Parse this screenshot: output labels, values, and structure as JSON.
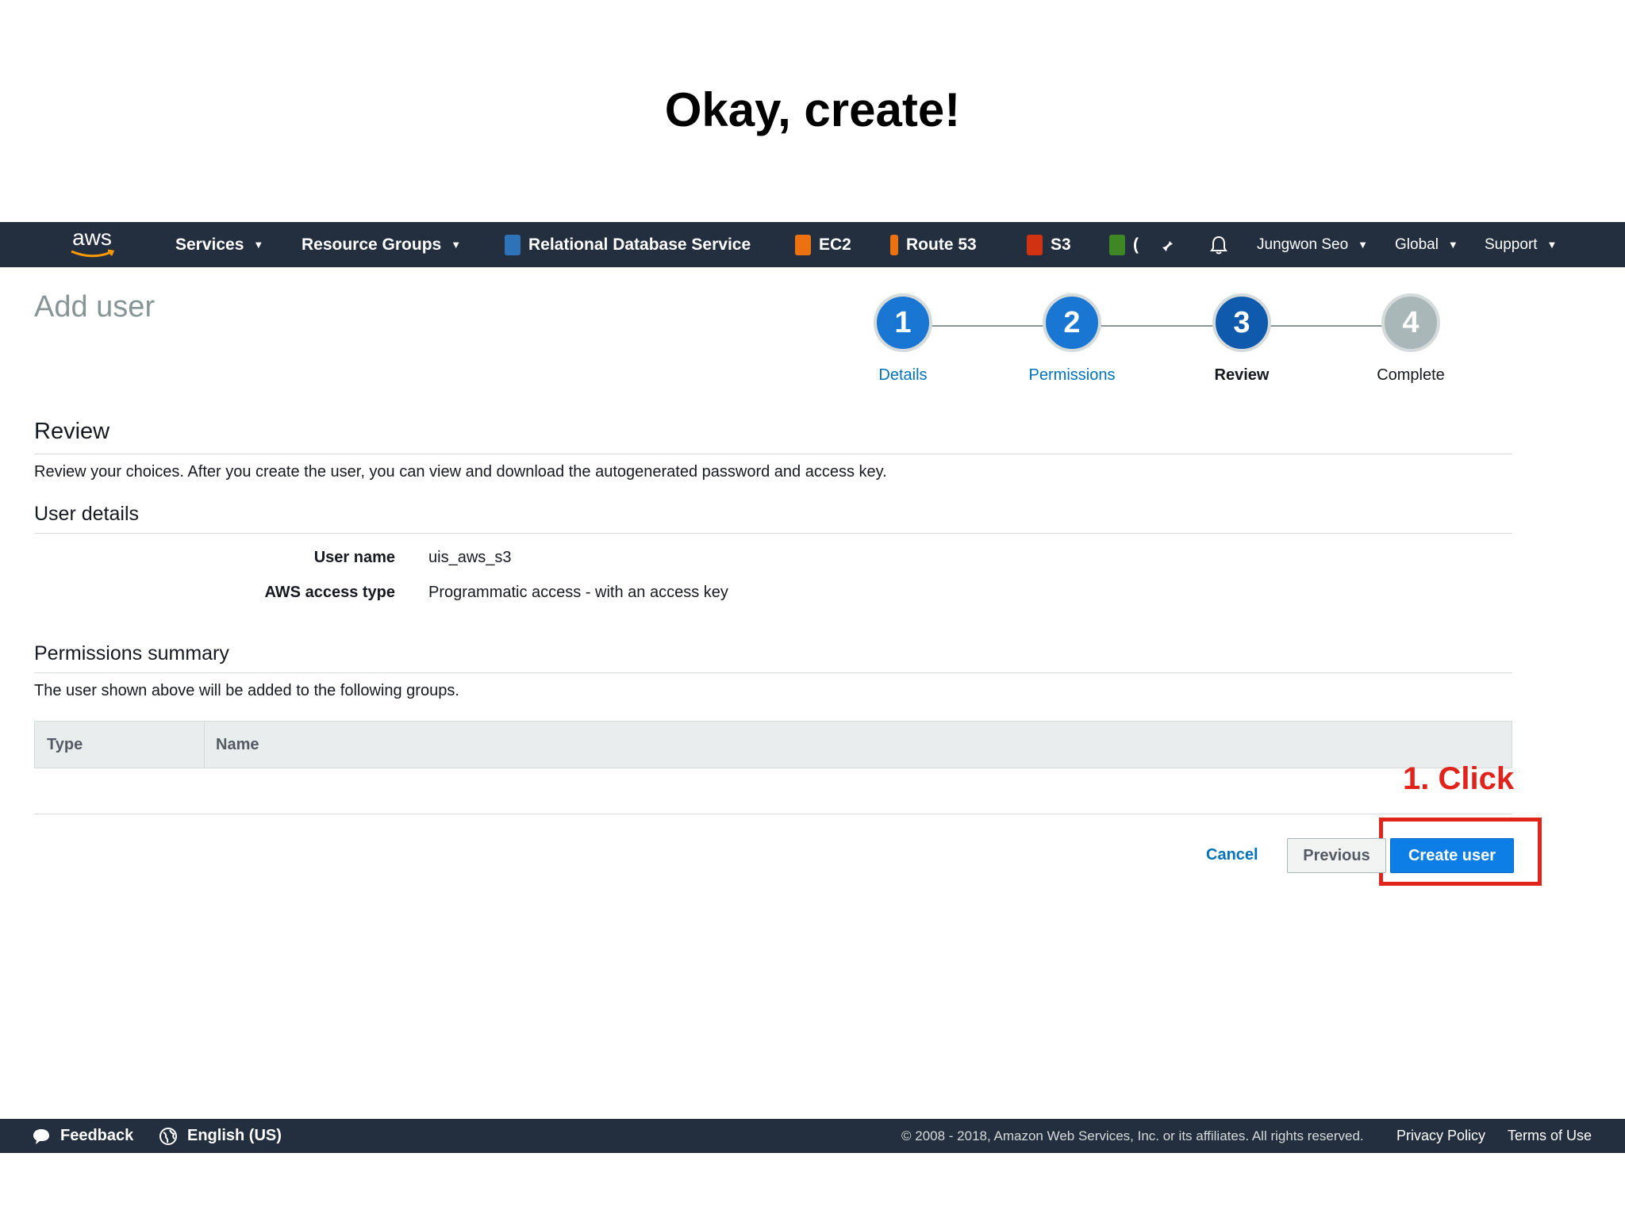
{
  "slide": {
    "title": "Okay, create!"
  },
  "nav": {
    "logo": "aws",
    "services": "Services",
    "resource_groups": "Resource Groups",
    "shortcuts": [
      "Relational Database Service",
      "EC2",
      "Route 53",
      "S3"
    ],
    "truncated": "(",
    "user": "Jungwon Seo",
    "region": "Global",
    "support": "Support"
  },
  "page": {
    "title": "Add user",
    "steps": [
      {
        "number": "1",
        "label": "Details"
      },
      {
        "number": "2",
        "label": "Permissions"
      },
      {
        "number": "3",
        "label": "Review"
      },
      {
        "number": "4",
        "label": "Complete"
      }
    ],
    "review_heading": "Review",
    "review_text": "Review your choices. After you create the user, you can view and download the autogenerated password and access key.",
    "user_details_heading": "User details",
    "user_name_label": "User name",
    "user_name_value": "uis_aws_s3",
    "access_type_label": "AWS access type",
    "access_type_value": "Programmatic access - with an access key",
    "permissions_heading": "Permissions summary",
    "permissions_text": "The user shown above will be added to the following groups.",
    "table": {
      "columns": [
        "Type",
        "Name"
      ]
    },
    "cancel": "Cancel",
    "previous": "Previous",
    "create_user": "Create user"
  },
  "annotation": {
    "text": "1. Click"
  },
  "footer": {
    "feedback": "Feedback",
    "language": "English (US)",
    "copyright": "© 2008 - 2018, Amazon Web Services, Inc. or its affiliates. All rights reserved.",
    "privacy": "Privacy Policy",
    "terms": "Terms of Use"
  },
  "colors": {
    "nav_bg": "#232f3e",
    "primary": "#0d7ee6",
    "link": "#0073bb",
    "annotation_red": "#e0231b"
  }
}
